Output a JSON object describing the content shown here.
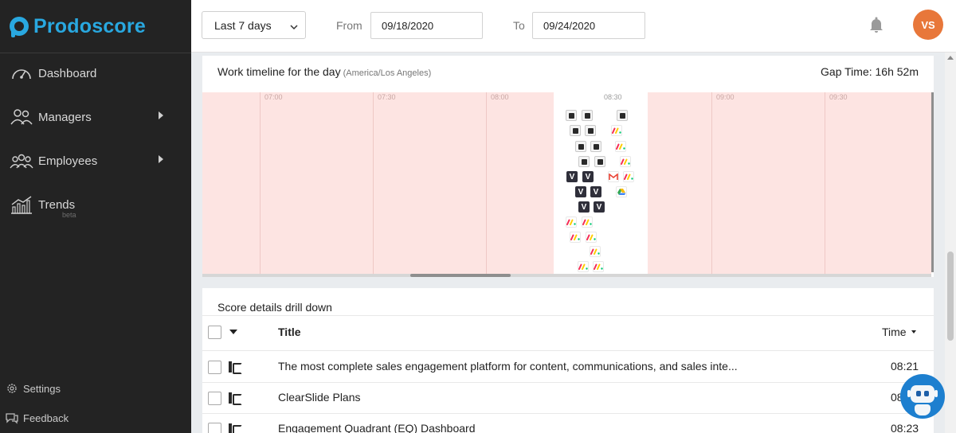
{
  "brand": {
    "name": "Prodoscore"
  },
  "sidebar": {
    "items": [
      {
        "label": "Dashboard",
        "icon": "gauge-icon",
        "has_submenu": false
      },
      {
        "label": "Managers",
        "icon": "managers-icon",
        "has_submenu": true
      },
      {
        "label": "Employees",
        "icon": "employees-icon",
        "has_submenu": true
      },
      {
        "label": "Trends",
        "icon": "trends-icon",
        "has_submenu": false,
        "badge": "beta"
      }
    ],
    "footer": [
      {
        "label": "Settings",
        "icon": "gear-icon"
      },
      {
        "label": "Feedback",
        "icon": "feedback-icon"
      }
    ]
  },
  "header": {
    "range": "Last 7 days",
    "from_label": "From",
    "from_value": "09/18/2020",
    "to_label": "To",
    "to_value": "09/24/2020",
    "avatar_initials": "VS"
  },
  "timeline": {
    "title": "Work timeline for the day",
    "timezone": "(America/Los Angeles)",
    "gap_time": "Gap Time: 16h 52m",
    "ticks": [
      "07:00",
      "07:30",
      "08:00",
      "08:30",
      "09:00",
      "09:30"
    ]
  },
  "details": {
    "title": "Score details drill down",
    "columns": {
      "title": "Title",
      "time": "Time"
    },
    "rows": [
      {
        "title": "The most complete sales engagement platform for content, communications, and sales inte...",
        "time": "08:21"
      },
      {
        "title": "ClearSlide Plans",
        "time": "08:22"
      },
      {
        "title": "Engagement Quadrant (EQ) Dashboard",
        "time": "08:23"
      }
    ]
  },
  "colors": {
    "sidebar_bg": "#232323",
    "brand": "#29a8e0",
    "gap_bg": "#fde4e2",
    "avatar": "#e8773a",
    "bot": "#1d7fcf"
  }
}
